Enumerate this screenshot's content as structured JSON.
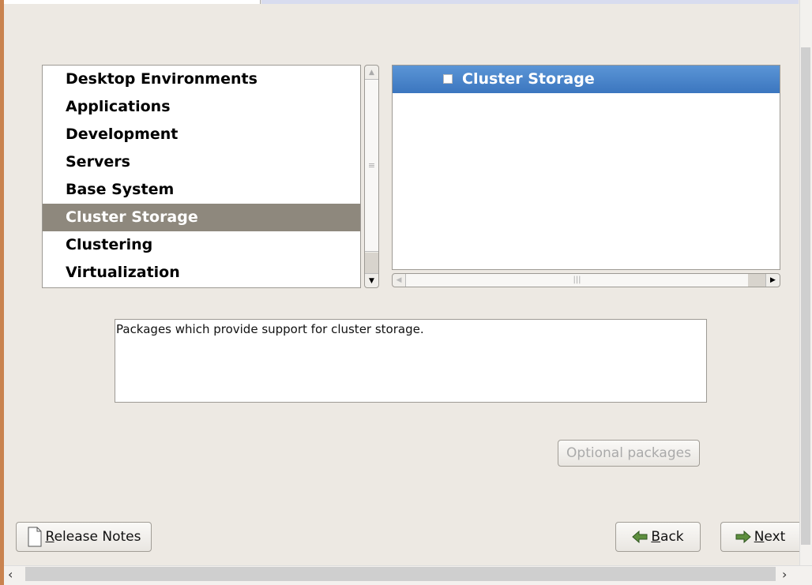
{
  "groups": {
    "items": [
      {
        "label": "Desktop Environments",
        "selected": false
      },
      {
        "label": "Applications",
        "selected": false
      },
      {
        "label": "Development",
        "selected": false
      },
      {
        "label": "Servers",
        "selected": false
      },
      {
        "label": "Base System",
        "selected": false
      },
      {
        "label": "Cluster Storage",
        "selected": true
      },
      {
        "label": "Clustering",
        "selected": false
      },
      {
        "label": "Virtualization",
        "selected": false
      }
    ]
  },
  "packages": {
    "items": [
      {
        "label": "Cluster Storage",
        "checked": false
      }
    ]
  },
  "description": "Packages which provide support for cluster storage.",
  "buttons": {
    "optional_packages": "Optional packages",
    "release_notes": {
      "mnemonic": "R",
      "rest": "elease Notes"
    },
    "back": {
      "mnemonic": "B",
      "rest": "ack"
    },
    "next": {
      "mnemonic": "N",
      "rest": "ext"
    }
  },
  "colors": {
    "selection_group": "#8e887d",
    "selection_package": "#4a86cc",
    "background": "#ede9e3"
  }
}
